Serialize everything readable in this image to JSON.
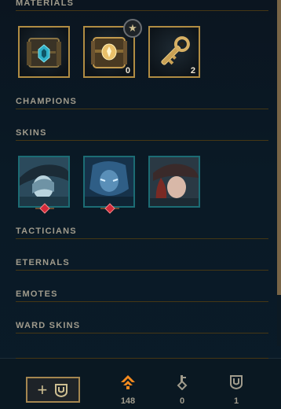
{
  "sections": {
    "materials": "MATERIALS",
    "champions": "CHAMPIONS",
    "skins": "SKINS",
    "tacticians": "TACTICIANS",
    "eternals": "ETERNALS",
    "emotes": "EMOTES",
    "ward_skins": "WARD SKINS"
  },
  "materials": [
    {
      "icon": "hextech-chest-icon",
      "count": ""
    },
    {
      "icon": "masterwork-chest-icon",
      "count": "0"
    },
    {
      "icon": "hextech-key-icon",
      "count": "2"
    }
  ],
  "star_badge": "★",
  "skins": [
    {
      "icon": "skin-portrait-1-icon",
      "rarity_gem": true
    },
    {
      "icon": "skin-portrait-2-icon",
      "rarity_gem": true
    },
    {
      "icon": "skin-portrait-3-icon",
      "rarity_gem": false
    }
  ],
  "footer": {
    "add_button_plus": "+",
    "orange_essence": "148",
    "key_fragments": "0",
    "chests": "1"
  },
  "colors": {
    "gold_border": "#b08c43",
    "teal_border": "#1c6c74",
    "header_text": "#a09b8c",
    "divider": "#463714",
    "orange_essence": "#f58a1f",
    "gem_red": "#d42a3a"
  }
}
